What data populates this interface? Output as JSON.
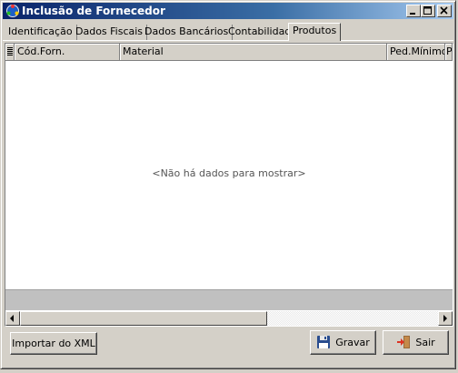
{
  "window": {
    "title": "Inclusão de Fornecedor",
    "icon": "app-icon"
  },
  "tabs": [
    {
      "label": "Identificação",
      "active": false
    },
    {
      "label": "Dados Fiscais",
      "active": false
    },
    {
      "label": "Dados Bancários",
      "active": false
    },
    {
      "label": "Contabilidade",
      "active": false
    },
    {
      "label": "Produtos",
      "active": true
    }
  ],
  "grid": {
    "columns": [
      "Cód.Forn.",
      "Material",
      "Ped.Mínimo",
      "P"
    ],
    "empty_message": "<Não há dados para mostrar>"
  },
  "buttons": {
    "import_xml": "Importar do XML",
    "save": "Gravar",
    "exit": "Sair"
  },
  "colors": {
    "titlebar_start": "#0a246a",
    "titlebar_end": "#a6caf0",
    "face": "#d4d0c8"
  }
}
